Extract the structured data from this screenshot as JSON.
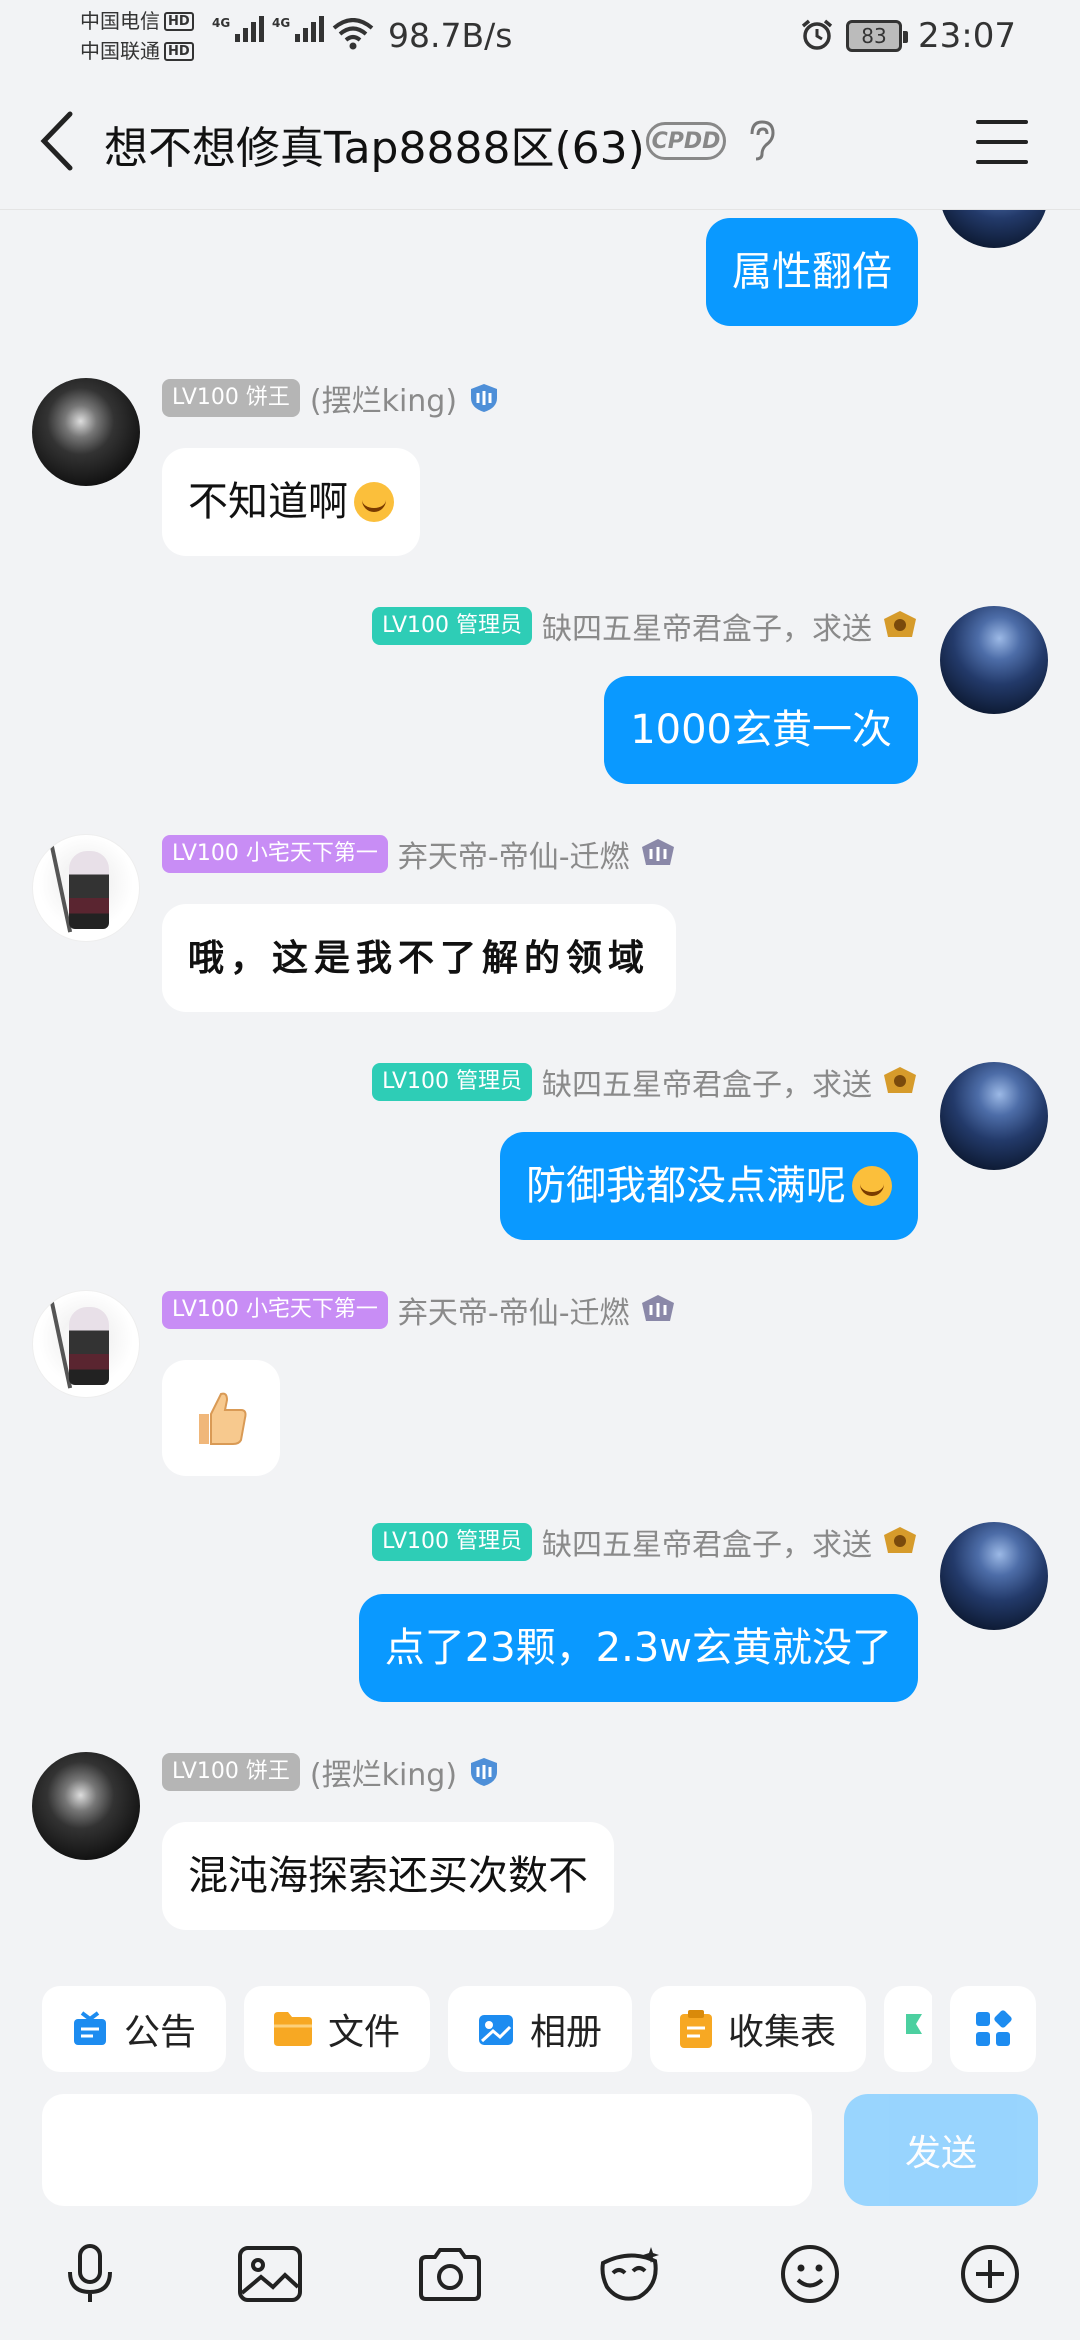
{
  "status_bar": {
    "carrier1": "中国电信",
    "carrier2": "中国联通",
    "hd": "HD",
    "network1": "4G",
    "network2": "4G",
    "net_speed": "98.7B/s",
    "battery": "83",
    "time": "23:07"
  },
  "header": {
    "title": "想不想修真Tap8888区(63)",
    "cpdd": "CPDD"
  },
  "messages": [
    {
      "side": "out",
      "text": "属性翻倍"
    },
    {
      "side": "in",
      "badge": "LV100 饼王",
      "sender": "(摆烂king)",
      "text": "不知道啊"
    },
    {
      "side": "out",
      "badge": "LV100 管理员",
      "sender": "缺四五星帝君盒子，求送",
      "text": "1000玄黄一次"
    },
    {
      "side": "in",
      "badge": "LV100 小宅天下第一",
      "sender": "弃天帝-帝仙-迁燃",
      "text": "哦，这是我不了解的领域"
    },
    {
      "side": "out",
      "badge": "LV100 管理员",
      "sender": "缺四五星帝君盒子，求送",
      "text": "防御我都没点满呢"
    },
    {
      "side": "in",
      "badge": "LV100 小宅天下第一",
      "sender": "弃天帝-帝仙-迁燃",
      "text": ""
    },
    {
      "side": "out",
      "badge": "LV100 管理员",
      "sender": "缺四五星帝君盒子，求送",
      "text": "点了23颗，2.3w玄黄就没了"
    },
    {
      "side": "in",
      "badge": "LV100 饼王",
      "sender": "(摆烂king)",
      "text": "混沌海探索还买次数不"
    }
  ],
  "toolbar": {
    "chips": [
      "公告",
      "文件",
      "相册",
      "收集表"
    ],
    "send": "发送",
    "input_placeholder": ""
  },
  "colors": {
    "bubble_out": "#0a99ff",
    "badge_admin": "#2ecdb6",
    "badge_purple": "#c88df5",
    "badge_gray": "#b5b5b5",
    "send_disabled": "#8fd1ff"
  }
}
